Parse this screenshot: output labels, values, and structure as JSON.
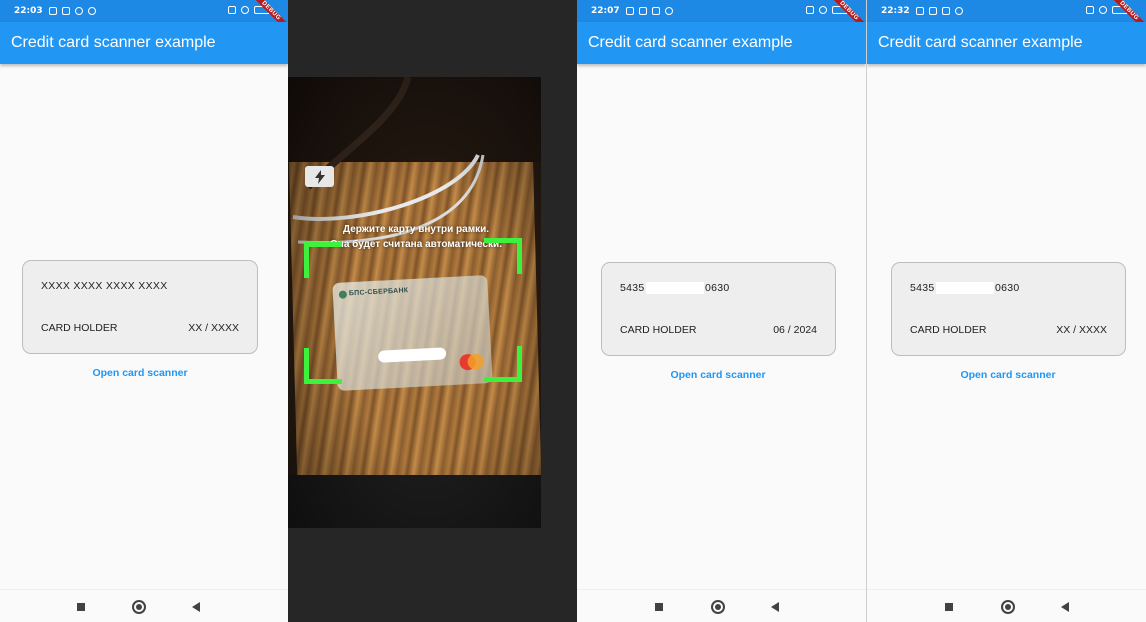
{
  "panels": [
    {
      "status_time": "22:03",
      "app_title": "Credit card scanner example",
      "card": {
        "number": "XXXX XXXX XXXX XXXX",
        "number_start": "",
        "number_end": "",
        "holder": "CARD HOLDER",
        "expiry": "XX / XXXX"
      },
      "link": "Open card scanner"
    },
    {
      "status_time": "22:07",
      "app_title": "Credit card scanner example",
      "card": {
        "number": "",
        "number_start": "5435",
        "number_end": "0630",
        "holder": "CARD HOLDER",
        "expiry": "06 / 2024"
      },
      "link": "Open card scanner"
    },
    {
      "status_time": "22:32",
      "app_title": "Credit card scanner example",
      "card": {
        "number": "",
        "number_start": "5435",
        "number_end": "0630",
        "holder": "CARD HOLDER",
        "expiry": "XX / XXXX"
      },
      "link": "Open card scanner"
    }
  ],
  "debug_banner": "DEBUG",
  "camera": {
    "bank_name": "БПС-СБЕРБАНК",
    "instruction_line1": "Держите карту внутри рамки.",
    "instruction_line2": "Она будет считана автоматически.",
    "flash_icon": "lightning-icon",
    "frame_color": "#3df23d"
  },
  "colors": {
    "app_bar": "#2196f3",
    "status_bar": "#1e88e5",
    "link": "#2196f3",
    "card_bg": "#eeeeee"
  },
  "nav_icons": [
    "recent-apps-icon",
    "home-icon",
    "back-icon"
  ]
}
